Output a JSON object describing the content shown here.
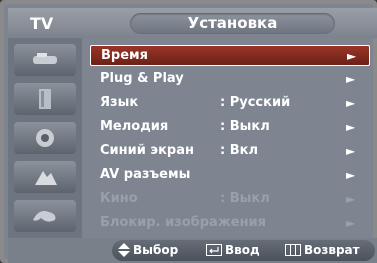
{
  "header": {
    "source": "TV",
    "title": "Установка"
  },
  "sidebar": {
    "icons": [
      "picture-icon",
      "sound-icon",
      "channel-icon",
      "setup-icon",
      "input-icon"
    ]
  },
  "menu": {
    "items": [
      {
        "label": "Время",
        "value": "",
        "arrow": "►",
        "state": "selected"
      },
      {
        "label": "Plug & Play",
        "value": "",
        "arrow": "►",
        "state": "normal"
      },
      {
        "label": "Язык",
        "value": ": Русский",
        "arrow": "►",
        "state": "normal"
      },
      {
        "label": "Мелодия",
        "value": ": Выкл",
        "arrow": "►",
        "state": "normal"
      },
      {
        "label": "Синий экран",
        "value": ": Вкл",
        "arrow": "►",
        "state": "normal"
      },
      {
        "label": "AV разъемы",
        "value": "",
        "arrow": "►",
        "state": "normal"
      },
      {
        "label": "Кино",
        "value": ": Выкл",
        "arrow": "►",
        "state": "disabled"
      },
      {
        "label": "Блокир. изображения",
        "value": "",
        "arrow": "►",
        "state": "disabled"
      }
    ]
  },
  "footer": {
    "select_label": "Выбор",
    "enter_label": "Ввод",
    "return_label": "Возврат"
  }
}
